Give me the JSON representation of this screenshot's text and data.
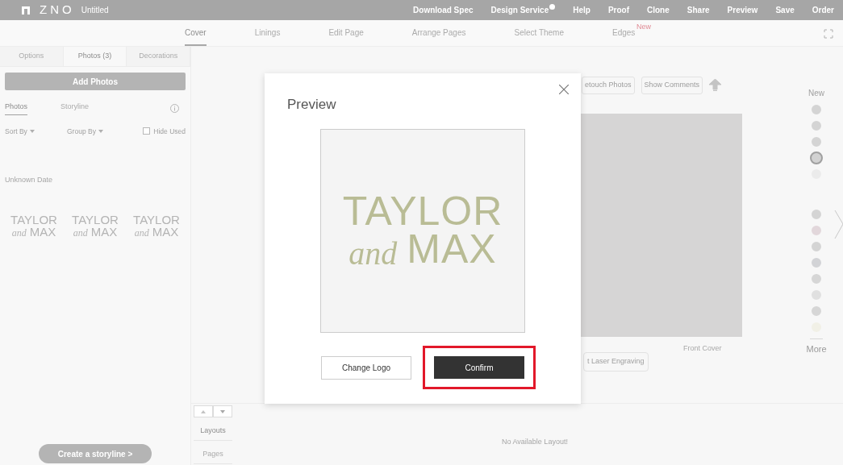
{
  "top_bar": {
    "logo": "ZNO",
    "title": "Untitled",
    "menu": [
      {
        "label": "Download Spec",
        "badge": false
      },
      {
        "label": "Design Service",
        "badge": true
      },
      {
        "label": "Help",
        "badge": false
      },
      {
        "label": "Proof",
        "badge": false
      },
      {
        "label": "Clone",
        "badge": false
      },
      {
        "label": "Share",
        "badge": false
      },
      {
        "label": "Preview",
        "badge": false
      },
      {
        "label": "Save",
        "badge": false
      },
      {
        "label": "Order",
        "badge": false
      }
    ]
  },
  "tabs": [
    {
      "label": "Cover",
      "selected": true
    },
    {
      "label": "Linings",
      "selected": false
    },
    {
      "label": "Edit Page",
      "selected": false
    },
    {
      "label": "Arrange Pages",
      "selected": false
    },
    {
      "label": "Select Theme",
      "selected": false
    },
    {
      "label": "Edges",
      "selected": false,
      "badge": "New"
    }
  ],
  "left_panel": {
    "tabs": [
      {
        "label": "Options",
        "selected": false
      },
      {
        "label": "Photos (3)",
        "selected": true
      },
      {
        "label": "Decorations",
        "selected": false
      }
    ],
    "add_button": "Add Photos",
    "sub_tabs": [
      {
        "label": "Photos",
        "selected": true
      },
      {
        "label": "Storyline",
        "selected": false
      }
    ],
    "sort": "Sort By",
    "group": "Group By",
    "hide_used": {
      "label": "Hide Used",
      "checked": false
    },
    "date_heading": "Unknown Date",
    "photos": [
      {
        "top": "TAYLOR",
        "script": "and",
        "bottom": "MAX"
      },
      {
        "top": "TAYLOR",
        "script": "and",
        "bottom": "MAX"
      },
      {
        "top": "TAYLOR",
        "script": "and",
        "bottom": "MAX"
      }
    ],
    "storyline_button": "Create a storyline >"
  },
  "toolbar": [
    "etouch Photos",
    "Show Comments"
  ],
  "cover": {
    "caption": "Front Cover",
    "engraving_button": "t Laser Engraving"
  },
  "bottom": {
    "tabs": [
      {
        "label": "Layouts",
        "selected": true
      },
      {
        "label": "Pages",
        "selected": false
      }
    ],
    "empty_message": "No Available Layout!"
  },
  "swatches": {
    "new_label": "New",
    "more_label": "More",
    "new_colors": [
      {
        "color": "#d4d4d4",
        "selected": false
      },
      {
        "color": "#d4d4d4",
        "selected": false
      },
      {
        "color": "#d4d4d4",
        "selected": false
      },
      {
        "color": "#d2d2d2",
        "selected": true
      },
      {
        "color": "#ebebeb",
        "selected": false
      }
    ],
    "colors": [
      {
        "color": "#d4d4d4",
        "selected": false
      },
      {
        "color": "#e2d7db",
        "selected": false
      },
      {
        "color": "#d4d4d4",
        "selected": false
      },
      {
        "color": "#d2d3d6",
        "selected": false
      },
      {
        "color": "#d6d6d6",
        "selected": false
      },
      {
        "color": "#e0e0e0",
        "selected": false
      },
      {
        "color": "#d6d6d6",
        "selected": false
      },
      {
        "color": "#f1f0e6",
        "selected": false
      }
    ]
  },
  "dialog": {
    "title": "Preview",
    "logo": {
      "top": "TAYLOR",
      "script": "and",
      "bottom": "MAX"
    },
    "buttons": [
      {
        "label": "Change Logo",
        "kind": "secondary"
      },
      {
        "label": "Confirm",
        "kind": "primary",
        "highlighted": true
      }
    ]
  }
}
